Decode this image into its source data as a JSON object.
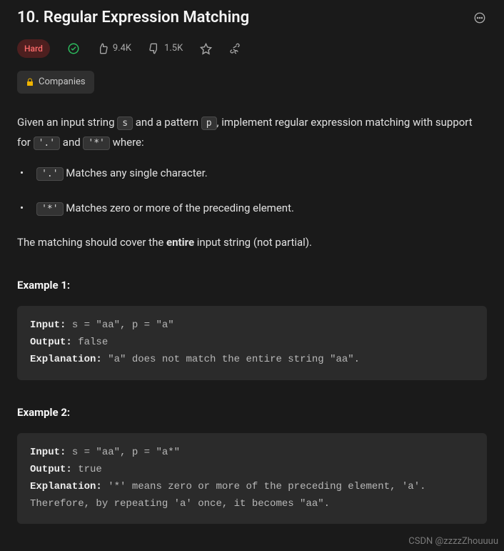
{
  "title": "10. Regular Expression Matching",
  "difficulty": "Hard",
  "likes": "9.4K",
  "dislikes": "1.5K",
  "companies_label": "Companies",
  "description": {
    "p1_a": "Given an input string ",
    "code_s": "s",
    "p1_b": " and a pattern ",
    "code_p": "p",
    "p1_c": ", implement regular expression matching with support for ",
    "code_dot": "'.'",
    "p1_d": " and ",
    "code_star": "'*'",
    "p1_e": " where:",
    "bullet1_code": "'.'",
    "bullet1_text": " Matches any single character.​​​​",
    "bullet2_code": "'*'",
    "bullet2_text": " Matches zero or more of the preceding element.",
    "p2_a": "The matching should cover the ",
    "p2_bold": "entire",
    "p2_b": " input string (not partial)."
  },
  "examples": [
    {
      "label": "Example 1:",
      "input_kw": "Input:",
      "input_val": " s = \"aa\", p = \"a\"",
      "output_kw": "Output:",
      "output_val": " false",
      "expl_kw": "Explanation:",
      "expl_val": " \"a\" does not match the entire string \"aa\"."
    },
    {
      "label": "Example 2:",
      "input_kw": "Input:",
      "input_val": " s = \"aa\", p = \"a*\"",
      "output_kw": "Output:",
      "output_val": " true",
      "expl_kw": "Explanation:",
      "expl_val": " '*' means zero or more of the preceding element, 'a'. Therefore, by repeating 'a' once, it becomes \"aa\"."
    }
  ],
  "watermark": "CSDN @zzzzZhouuuu"
}
